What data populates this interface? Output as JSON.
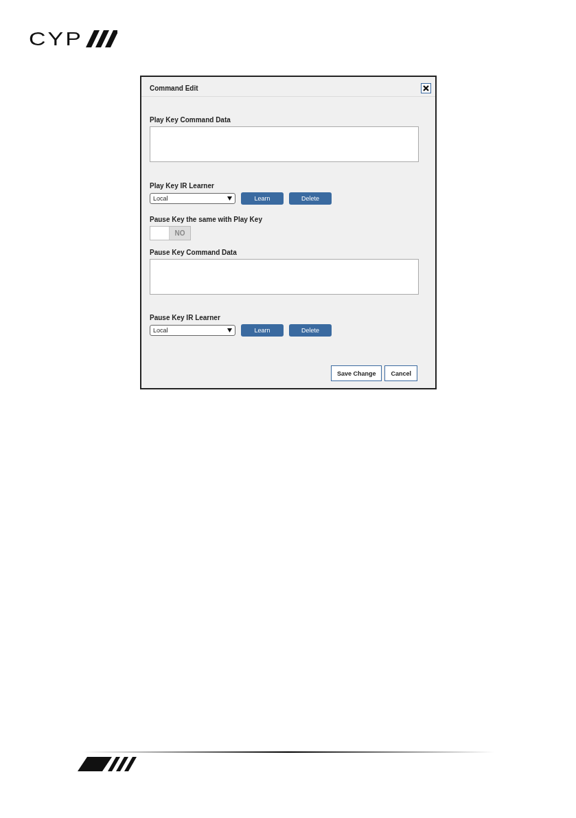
{
  "header": {
    "logo": "CYP"
  },
  "dialog": {
    "title": "Command Edit",
    "sections": [
      {
        "kind": "textarea",
        "label": "Play Key Command Data"
      },
      {
        "kind": "learner",
        "label": "Play Key IR Learner",
        "select": "Local",
        "buttons": [
          "Learn",
          "Delete"
        ]
      },
      {
        "kind": "toggle",
        "label": "Pause Key the same with Play Key",
        "toggle": {
          "label": "NO",
          "on": false
        }
      },
      {
        "kind": "textarea",
        "label": "Pause Key Command Data"
      },
      {
        "kind": "learner",
        "label": "Pause Key IR Learner",
        "select": "Local",
        "buttons": [
          "Learn",
          "Delete"
        ]
      }
    ],
    "footer_buttons": [
      "Save Change",
      "Cancel"
    ]
  }
}
